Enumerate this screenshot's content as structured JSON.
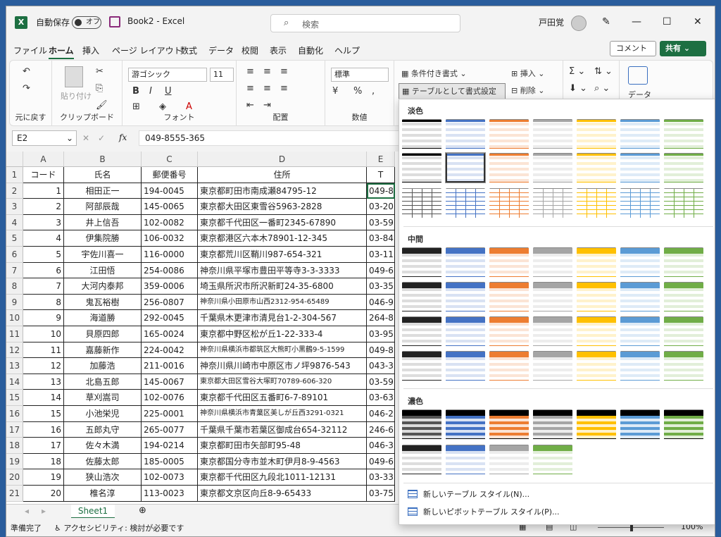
{
  "titlebar": {
    "autosave_label": "自動保存",
    "autosave_state": "オフ",
    "book_title": "Book2 - Excel",
    "search_placeholder": "検索",
    "user": "戸田覚"
  },
  "menu": [
    "ファイル",
    "ホーム",
    "挿入",
    "ページ レイアウト",
    "数式",
    "データ",
    "校閲",
    "表示",
    "自動化",
    "ヘルプ"
  ],
  "active_menu": "ホーム",
  "buttons": {
    "comment": "コメント",
    "share": "共有"
  },
  "ribbon": {
    "undo_group": "元に戻す",
    "paste_label": "貼り付け",
    "clipboard_group": "クリップボード",
    "font_name": "游ゴシック",
    "font_size": "11",
    "bold": "B",
    "italic": "I",
    "underline": "U",
    "font_group": "フォント",
    "align_group": "配置",
    "number_format": "標準",
    "number_group": "数値",
    "cond_format": "条件付き書式",
    "table_format": "テーブルとして書式設定",
    "insert": "挿入",
    "delete": "削除",
    "data": "データ"
  },
  "formula": {
    "namebox": "E2",
    "fx": "fx",
    "value": "049-8555-365"
  },
  "columns": [
    {
      "label": "A"
    },
    {
      "label": "B"
    },
    {
      "label": "C"
    },
    {
      "label": "D"
    },
    {
      "label": "E"
    }
  ],
  "header_row": [
    "コード",
    "氏名",
    "郵便番号",
    "住所",
    "T"
  ],
  "rows": [
    [
      "1",
      "相田正一",
      "194-0045",
      "東京都町田市南成瀬84795-12",
      "049-8"
    ],
    [
      "2",
      "阿部辰哉",
      "145-0065",
      "東京都大田区東雪谷5963-2828",
      "03-20"
    ],
    [
      "3",
      "井上信吾",
      "102-0082",
      "東京都千代田区一番町2345-67890",
      "03-59"
    ],
    [
      "4",
      "伊集院勝",
      "106-0032",
      "東京都港区六本木78901-12-345",
      "03-84"
    ],
    [
      "5",
      "宇佐川喜一",
      "116-0000",
      "東京都荒川区鞘川987-654-321",
      "03-11"
    ],
    [
      "6",
      "江田悟",
      "254-0086",
      "神奈川県平塚市豊田平等寺3-3-3333",
      "049-6"
    ],
    [
      "7",
      "大河内泰邦",
      "359-0006",
      "埼玉県所沢市所沢新町24-35-6800",
      "03-35"
    ],
    [
      "8",
      "鬼瓦裕樹",
      "256-0807",
      "神奈川県小田原市山西2312-954-65489",
      "046-9"
    ],
    [
      "9",
      "海道勝",
      "292-0045",
      "千葉県木更津市清見台1-2-304-567",
      "264-8"
    ],
    [
      "10",
      "貝原四郎",
      "165-0024",
      "東京都中野区松が丘1-22-333-4",
      "03-95"
    ],
    [
      "11",
      "嘉藤新作",
      "224-0042",
      "神奈川県横浜市都筑区大熊町小黒鶴9-5-1599",
      "049-8"
    ],
    [
      "12",
      "加藤浩",
      "211-0016",
      "神奈川県川崎市中原区市ノ坪9876-543",
      "043-3"
    ],
    [
      "13",
      "北島五郎",
      "145-0067",
      "東京都大田区雪谷大塚町70789-606-320",
      "03-59"
    ],
    [
      "14",
      "草刈嵩司",
      "102-0076",
      "東京都千代田区五番町6-7-89101",
      "03-63"
    ],
    [
      "15",
      "小池栄児",
      "225-0001",
      "神奈川県横浜市青葉区美しが丘西3291-0321",
      "046-2"
    ],
    [
      "16",
      "五郎丸守",
      "265-0077",
      "千葉県千葉市若葉区御成台654-32112",
      "246-6"
    ],
    [
      "17",
      "佐々木満",
      "194-0214",
      "東京都町田市矢部町95-48",
      "046-3"
    ],
    [
      "18",
      "佐藤太郎",
      "185-0005",
      "東京都国分寺市並木町伊月8-9-4563",
      "049-6"
    ],
    [
      "19",
      "狭山浩次",
      "102-0073",
      "東京都千代田区九段北1011-12131",
      "03-33"
    ],
    [
      "20",
      "椎名淳",
      "113-0023",
      "東京都文京区向丘8-9-65433",
      "03-75"
    ]
  ],
  "row_numbers": [
    "1",
    "2",
    "3",
    "4",
    "5",
    "6",
    "7",
    "8",
    "9",
    "10",
    "11",
    "12",
    "13",
    "14",
    "15",
    "16",
    "17",
    "18",
    "19",
    "20",
    "21"
  ],
  "sheet_tab": "Sheet1",
  "status": {
    "ready": "準備完了",
    "accessibility": "アクセシビリティ: 検討が必要です",
    "zoom": "100%"
  },
  "gallery": {
    "light_title": "淡色",
    "medium_title": "中間",
    "dark_title": "濃色",
    "new_table_style": "新しいテーブル スタイル(N)...",
    "new_pivot_style": "新しいピボットテーブル スタイル(P)...",
    "colors": [
      "#555555",
      "#4472c4",
      "#ed7d31",
      "#a5a5a5",
      "#ffc000",
      "#5b9bd5",
      "#70ad47"
    ],
    "tints": [
      "#dddddd",
      "#d9e2f3",
      "#fbe4d5",
      "#ededed",
      "#fff2cc",
      "#deebf7",
      "#e2efd9"
    ]
  }
}
